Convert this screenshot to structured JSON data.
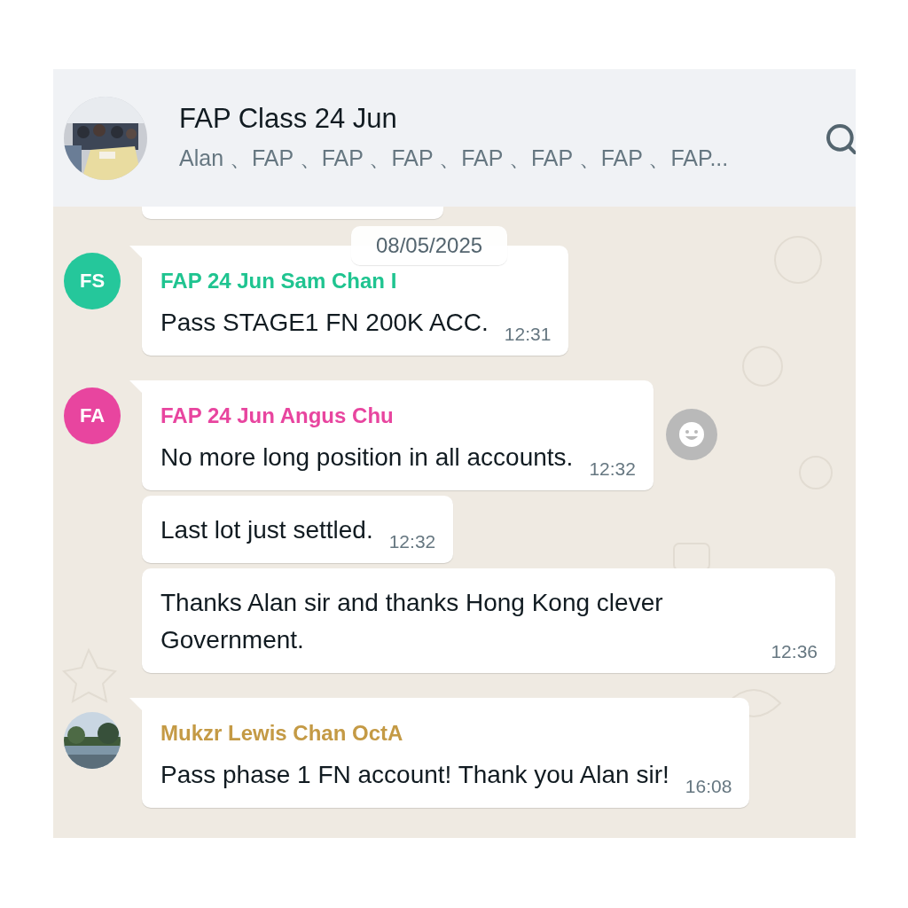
{
  "header": {
    "title": "FAP Class 24 Jun",
    "participants": "Alan 、FAP 、FAP 、FAP 、FAP 、FAP 、FAP 、FAP..."
  },
  "date_chip": "08/05/2025",
  "groups": [
    {
      "avatar": {
        "kind": "initials",
        "initials": "FS",
        "color": "#25c79b"
      },
      "sender": "FAP 24 Jun Sam Chan I",
      "color": "#1fc490",
      "show_reaction": false,
      "messages": [
        {
          "text": "Pass STAGE1 FN 200K ACC.",
          "time": "12:31"
        }
      ]
    },
    {
      "avatar": {
        "kind": "initials",
        "initials": "FA",
        "color": "#e8459f"
      },
      "sender": "FAP 24 Jun Angus Chu",
      "color": "#e8459f",
      "show_reaction": true,
      "messages": [
        {
          "text": "No more long position in all accounts.",
          "time": "12:32"
        },
        {
          "text": "Last lot just settled.",
          "time": "12:32"
        },
        {
          "text": "Thanks Alan sir and thanks Hong Kong clever Government.",
          "time": "12:36"
        }
      ]
    },
    {
      "sender": "Mukzr Lewis Chan OctA",
      "color": "#c49a45",
      "show_reaction": false,
      "messages": [
        {
          "text": "Pass phase 1 FN account! Thank you Alan sir!",
          "time": "16:08"
        }
      ]
    }
  ]
}
